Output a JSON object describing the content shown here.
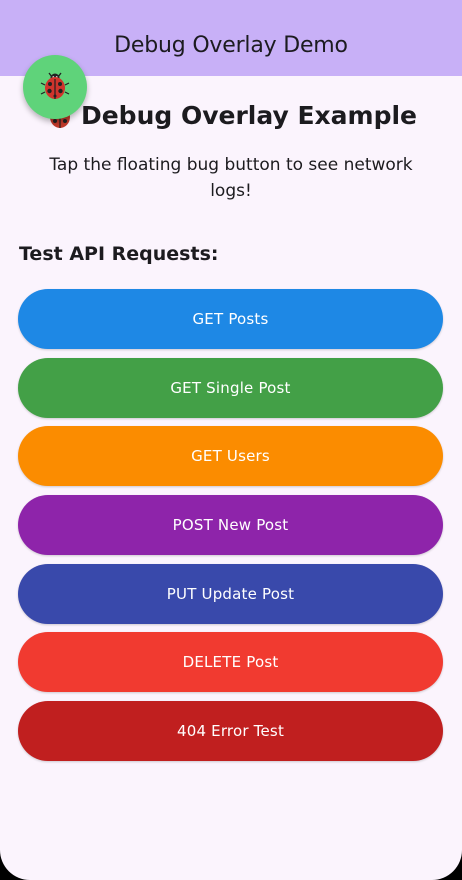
{
  "app_bar": {
    "title": "Debug Overlay Demo",
    "background": "#c8b0f7"
  },
  "fab": {
    "icon": "ladybug-icon",
    "background": "#5fd37a"
  },
  "main": {
    "heading": "Debug Overlay Example",
    "heading_icon": "ladybug-icon",
    "subtitle": "Tap the floating bug button to see network logs!",
    "section_title": "Test API Requests:",
    "buttons": [
      {
        "label": "GET Posts",
        "color": "#1e88e5"
      },
      {
        "label": "GET Single Post",
        "color": "#43a047"
      },
      {
        "label": "GET Users",
        "color": "#fb8c00"
      },
      {
        "label": "POST New Post",
        "color": "#8e24aa"
      },
      {
        "label": "PUT Update Post",
        "color": "#3949ab"
      },
      {
        "label": "DELETE Post",
        "color": "#f13a30"
      },
      {
        "label": "404 Error Test",
        "color": "#c01f1f"
      }
    ]
  }
}
